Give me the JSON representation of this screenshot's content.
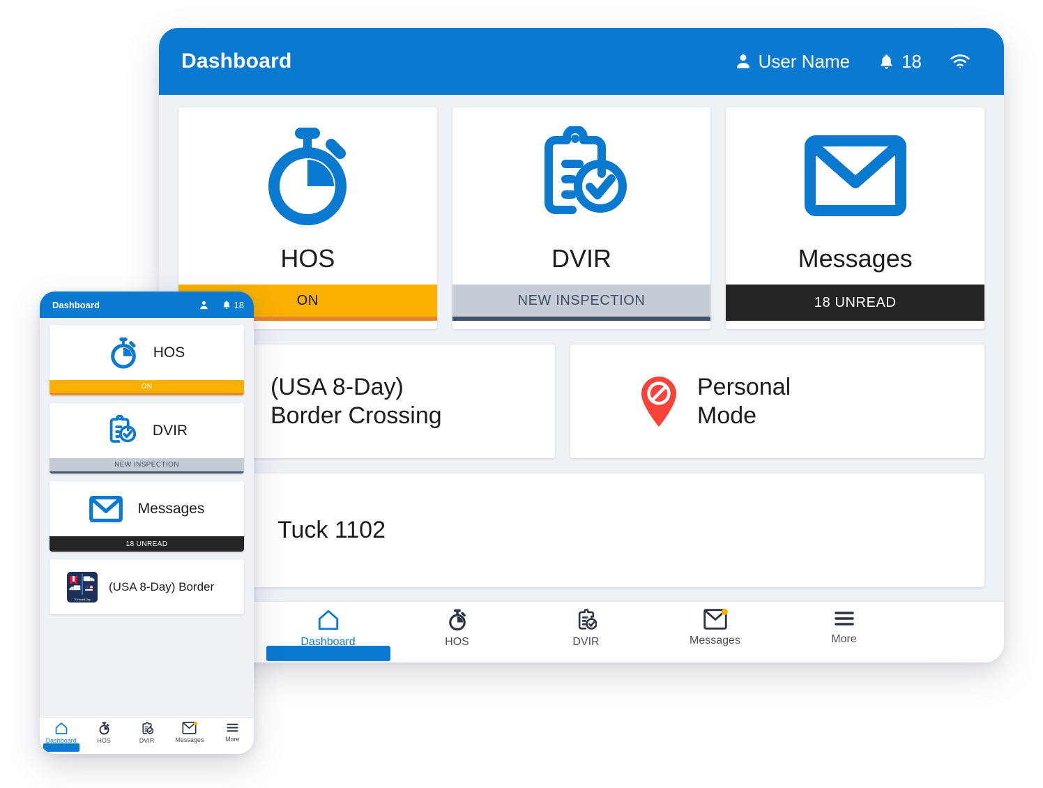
{
  "tablet": {
    "header": {
      "title": "Dashboard",
      "user_icon": "person-icon",
      "user_name": "User Name",
      "bell_icon": "bell-icon",
      "notification_count": "18",
      "wifi_icon": "wifi-icon"
    },
    "tiles": [
      {
        "icon": "stopwatch-icon",
        "label": "HOS",
        "status": "ON",
        "status_style": "on"
      },
      {
        "icon": "clipboard-check-icon",
        "label": "DVIR",
        "status": "NEW INSPECTION",
        "status_style": "grey"
      },
      {
        "icon": "envelope-icon",
        "label": "Messages",
        "status": "18 UNREAD",
        "status_style": "dark"
      }
    ],
    "cards": {
      "border": {
        "icon": "border-crossing-badge-icon",
        "badge_text": "70-Hour/8-Day",
        "line1": "(USA 8-Day)",
        "line2": "Border Crossing"
      },
      "personal": {
        "icon": "map-pin-no-entry-icon",
        "line1": "Personal",
        "line2": "Mode"
      },
      "vehicle": {
        "icon": "truck-icon",
        "label": "Tuck 1102"
      }
    },
    "nav": [
      {
        "icon": "home-icon",
        "label": "Dashboard",
        "active": true
      },
      {
        "icon": "stopwatch-icon",
        "label": "HOS",
        "active": false
      },
      {
        "icon": "clipboard-check-icon",
        "label": "DVIR",
        "active": false
      },
      {
        "icon": "envelope-badge-icon",
        "label": "Messages",
        "active": false
      },
      {
        "icon": "hamburger-icon",
        "label": "More",
        "active": false
      }
    ]
  },
  "phone": {
    "header": {
      "title": "Dashboard",
      "user_icon": "person-icon",
      "bell_icon": "bell-icon",
      "notification_count": "18"
    },
    "tiles": [
      {
        "icon": "stopwatch-icon",
        "label": "HOS",
        "status": "ON",
        "status_style": "on"
      },
      {
        "icon": "clipboard-check-icon",
        "label": "DVIR",
        "status": "NEW INSPECTION",
        "status_style": "grey"
      },
      {
        "icon": "envelope-icon",
        "label": "Messages",
        "status": "18 UNREAD",
        "status_style": "dark"
      }
    ],
    "border_card": {
      "icon": "border-crossing-badge-icon",
      "badge_text": "70-Hour/8-Day",
      "label": "(USA 8-Day) Border"
    },
    "nav": [
      {
        "icon": "home-icon",
        "label": "Dashboard",
        "active": true
      },
      {
        "icon": "stopwatch-icon",
        "label": "HOS",
        "active": false
      },
      {
        "icon": "clipboard-check-icon",
        "label": "DVIR",
        "active": false
      },
      {
        "icon": "envelope-badge-icon",
        "label": "Messages",
        "active": false
      },
      {
        "icon": "hamburger-icon",
        "label": "More",
        "active": false
      }
    ]
  },
  "colors": {
    "brand_blue": "#0a79d0",
    "status_orange": "#f9b000",
    "status_orange_edge": "#e8852a",
    "status_grey": "#c6ccd6",
    "status_grey_edge": "#3e5166",
    "status_dark": "#242424",
    "accent_red": "#f9423a",
    "page_bg": "#eef1f6",
    "badge_navy": "#1d3055"
  }
}
